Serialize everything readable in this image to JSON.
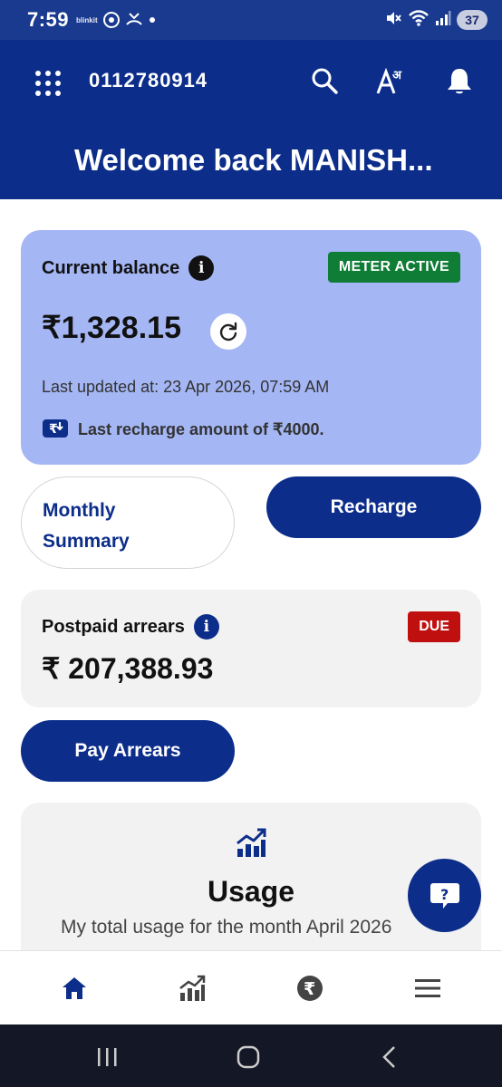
{
  "status_bar": {
    "time": "7:59",
    "app_label": "blinkit",
    "battery": "37"
  },
  "header": {
    "account_number": "0112780914",
    "welcome": "Welcome back MANISH...",
    "lang_icon_text": "Aअ"
  },
  "balance": {
    "title": "Current balance",
    "status_badge": "METER ACTIVE",
    "amount": "₹1,328.15",
    "last_updated": "Last updated at: 23 Apr 2026, 07:59 AM",
    "last_recharge": "Last recharge amount of ₹4000."
  },
  "actions": {
    "monthly_line1": "Monthly",
    "monthly_line2": "Summary",
    "recharge": "Recharge",
    "pay_arrears": "Pay Arrears"
  },
  "arrears": {
    "title": "Postpaid arrears",
    "badge": "DUE",
    "amount": "₹ 207,388.93"
  },
  "usage": {
    "title": "Usage",
    "subtitle": "My total usage for the month April 2026"
  },
  "bottom_nav": [
    "home-icon",
    "usage-chart-icon",
    "rupee-icon",
    "menu-icon"
  ],
  "colors": {
    "primary": "#0c2d8a",
    "balance_card": "#a4b6f4",
    "meter_active": "#0f7d36",
    "due": "#c00f0f"
  }
}
